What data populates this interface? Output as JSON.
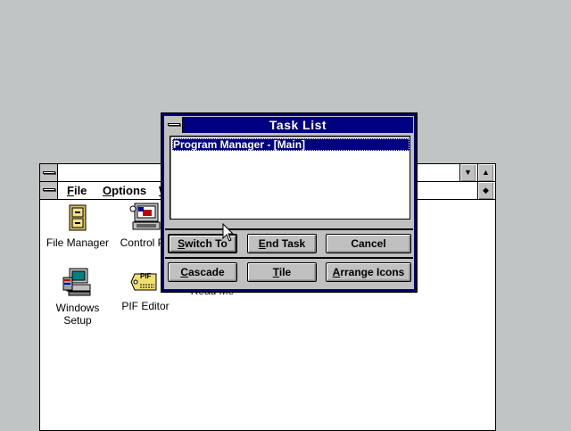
{
  "program_manager": {
    "menu": [
      {
        "label": "File",
        "access": "F",
        "rest": "ile"
      },
      {
        "label": "Options",
        "access": "O",
        "rest": "ptions"
      },
      {
        "label": "W",
        "access": "W",
        "rest": ""
      }
    ],
    "icons": [
      {
        "name": "file-manager",
        "label": "File Manager"
      },
      {
        "name": "control-panel",
        "label": "Control Pa"
      },
      {
        "name": "windows-setup",
        "label": "Windows Setup",
        "line1": "Windows",
        "line2": "Setup"
      },
      {
        "name": "pif-editor",
        "label": "PIF Editor",
        "badge": "PIF"
      },
      {
        "name": "read-me",
        "label": "Read Me"
      }
    ]
  },
  "task_list": {
    "title": "Task List",
    "items": [
      "Program Manager - [Main]"
    ],
    "selected_index": 0,
    "buttons": {
      "switch_to": {
        "label": "Switch To",
        "access": "S",
        "rest": "witch To"
      },
      "end_task": {
        "label": "End Task",
        "access": "E",
        "rest": "nd Task"
      },
      "cancel": {
        "label": "Cancel"
      },
      "cascade": {
        "label": "Cascade",
        "access": "C",
        "rest": "ascade"
      },
      "tile": {
        "label": "Tile",
        "access": "T",
        "rest": "ile"
      },
      "arrange_icons": {
        "label": "Arrange Icons",
        "access": "A",
        "rest": "rrange Icons"
      }
    }
  },
  "colors": {
    "desktop": "#c0c4c4",
    "title_active": "#000080",
    "button_face": "#c0c0c0",
    "selection": "#000080"
  },
  "icons": [
    "system-menu-icon",
    "minimize-icon",
    "maximize-icon",
    "restore-icon",
    "mouse-pointer-icon"
  ]
}
